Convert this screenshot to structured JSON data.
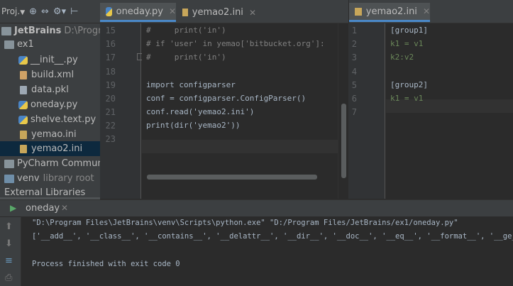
{
  "project_panel": {
    "toolbar_label": "Proj.",
    "items": [
      {
        "label": "JetBrains",
        "detail": "D:\\Program",
        "kind": "folder-root"
      },
      {
        "label": "ex1",
        "kind": "folder"
      },
      {
        "label": "__init__.py",
        "kind": "py"
      },
      {
        "label": "build.xml",
        "kind": "xml"
      },
      {
        "label": "data.pkl",
        "kind": "pkl"
      },
      {
        "label": "oneday.py",
        "kind": "py"
      },
      {
        "label": "shelve.text.py",
        "kind": "py"
      },
      {
        "label": "yemao.ini",
        "kind": "ini"
      },
      {
        "label": "yemao2.ini",
        "kind": "ini",
        "selected": true
      },
      {
        "label": "PyCharm Community",
        "kind": "folder"
      },
      {
        "label": "venv",
        "detail": "library root",
        "kind": "folder"
      },
      {
        "label": "External Libraries",
        "kind": "lib"
      }
    ]
  },
  "left_editor": {
    "tabs": [
      {
        "label": "oneday.py",
        "active": true
      },
      {
        "label": "yemao2.ini",
        "active": false
      }
    ],
    "line_numbers": [
      "15",
      "16",
      "17",
      "18",
      "19",
      "20",
      "21",
      "22",
      "23"
    ],
    "lines": [
      "#     print('in')",
      "# if 'user' in yemao['bitbucket.org']:",
      "#     print('in')",
      "",
      "import configparser",
      "conf = configparser.ConfigParser()",
      "conf.read('yemao2.ini')",
      "print(dir('yemao2'))",
      ""
    ]
  },
  "right_editor": {
    "tabs": [
      {
        "label": "yemao2.ini",
        "active": true
      }
    ],
    "line_numbers": [
      "1",
      "2",
      "3",
      "4",
      "5",
      "6",
      "7"
    ],
    "lines": [
      "[group1]",
      "k1 = v1",
      "k2:v2",
      "",
      "[group2]",
      "k1 = v1",
      ""
    ]
  },
  "run_panel": {
    "tab_label": "oneday",
    "output": [
      "\"D:\\Program Files\\JetBrains\\venv\\Scripts\\python.exe\" \"D:/Program Files/JetBrains/ex1/oneday.py\"",
      "['__add__', '__class__', '__contains__', '__delattr__', '__dir__', '__doc__', '__eq__', '__format__', '__ge__', '",
      "",
      "Process finished with exit code 0"
    ]
  },
  "colors": {
    "keyword": "#cc7832",
    "string": "#6a8759",
    "comment": "#808080",
    "builtin": "#8888c6",
    "selection": "#0d293e",
    "tab_underline": "#4a88c7"
  }
}
